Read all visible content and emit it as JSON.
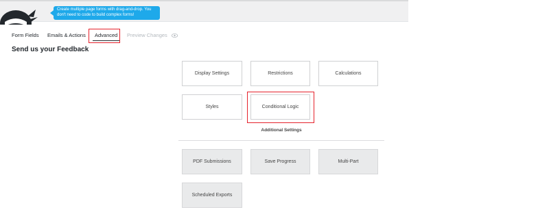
{
  "header": {
    "promo_line1": "Create multiple page forms with drag-and-drop. You",
    "promo_line2": "don't need to code to build complex forms!"
  },
  "tabs": {
    "form_fields": "Form Fields",
    "emails_actions": "Emails & Actions",
    "advanced": "Advanced",
    "preview_changes": "Preview Changes"
  },
  "page_title": "Send us your Feedback",
  "advanced_settings": {
    "display_settings": "Display Settings",
    "restrictions": "Restrictions",
    "calculations": "Calculations",
    "styles": "Styles",
    "conditional_logic": "Conditional Logic"
  },
  "additional_settings": {
    "label": "Additional Settings",
    "pdf_submissions": "PDF Submissions",
    "save_progress": "Save Progress",
    "multi_part": "Multi-Part",
    "scheduled_exports": "Scheduled Exports"
  },
  "colors": {
    "highlight": "#e5202a",
    "promo": "#1ea9ea",
    "logo": "#23282d"
  }
}
